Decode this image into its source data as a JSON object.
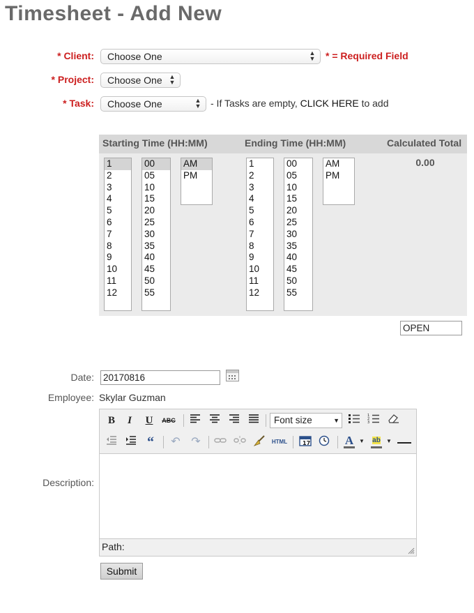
{
  "title": "Timesheet - Add New",
  "client": {
    "label": "* Client:",
    "value": "Choose One"
  },
  "required_note": "* = Required Field",
  "project": {
    "label": "* Project:",
    "value": "Choose One"
  },
  "task": {
    "label": "* Task:",
    "value": "Choose One",
    "note_prefix": "- If Tasks are empty,",
    "click_here": "CLICK HERE",
    "note_suffix": "to add"
  },
  "time": {
    "starting_header": "Starting Time (HH:MM)",
    "ending_header": "Ending Time (HH:MM)",
    "total_header": "Calculated Total",
    "total_value": "0.00",
    "hours": [
      "1",
      "2",
      "3",
      "4",
      "5",
      "6",
      "7",
      "8",
      "9",
      "10",
      "11",
      "12"
    ],
    "minutes": [
      "00",
      "05",
      "10",
      "15",
      "20",
      "25",
      "30",
      "35",
      "40",
      "45",
      "50",
      "55"
    ],
    "ampm": [
      "AM",
      "PM"
    ],
    "start_selected": {
      "hour": "1",
      "minute": "00",
      "ampm": "AM"
    }
  },
  "status_field": "OPEN",
  "date": {
    "label": "Date:",
    "value": "20170816"
  },
  "employee": {
    "label": "Employee:",
    "value": "Skylar Guzman"
  },
  "description": {
    "label": "Description:",
    "font_size_label": "Font size",
    "path_label": "Path:"
  },
  "submit_label": "Submit",
  "icons": [
    "bold-icon",
    "italic-icon",
    "underline-icon",
    "strikethrough-icon",
    "align-left-icon",
    "align-center-icon",
    "align-right-icon",
    "align-justify-icon",
    "unordered-list-icon",
    "ordered-list-icon",
    "eraser-icon",
    "outdent-icon",
    "indent-icon",
    "blockquote-icon",
    "undo-icon",
    "redo-icon",
    "link-icon",
    "unlink-icon",
    "cleanup-icon",
    "html-icon",
    "insert-date-icon",
    "insert-time-icon",
    "text-color-icon",
    "highlight-color-icon",
    "horizontal-rule-icon",
    "calendar-icon"
  ],
  "colors": {
    "required": "#cc1f1f",
    "title": "#6a6a6a",
    "panel": "#ebebeb",
    "panel_header": "#d8d8d8"
  }
}
